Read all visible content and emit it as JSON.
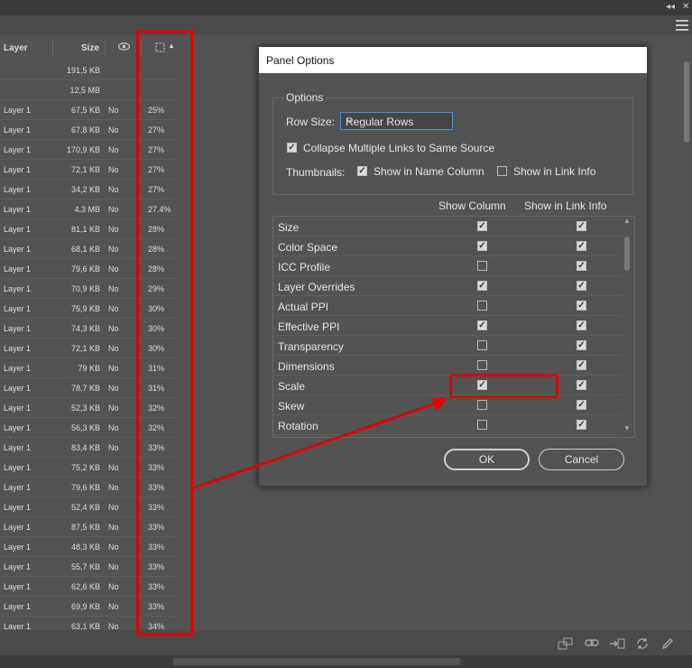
{
  "window": {
    "collapse_glyph": "◂◂",
    "close_glyph": "✕",
    "menu_icon": "hamburger-menu-icon"
  },
  "links_panel": {
    "columns": {
      "layer": "Layer",
      "size": "Size",
      "visibility_icon": "eye-icon",
      "scale_icon": "scale-column-icon",
      "sort_glyph": "▴"
    },
    "rows": [
      {
        "layer": "",
        "size": "191,5 KB",
        "vis": "",
        "scale": ""
      },
      {
        "layer": "",
        "size": "12,5 MB",
        "vis": "",
        "scale": ""
      },
      {
        "layer": "Layer 1",
        "size": "67,5 KB",
        "vis": "No",
        "scale": "25%"
      },
      {
        "layer": "Layer 1",
        "size": "67,8 KB",
        "vis": "No",
        "scale": "27%"
      },
      {
        "layer": "Layer 1",
        "size": "170,9 KB",
        "vis": "No",
        "scale": "27%"
      },
      {
        "layer": "Layer 1",
        "size": "72,1 KB",
        "vis": "No",
        "scale": "27%"
      },
      {
        "layer": "Layer 1",
        "size": "34,2 KB",
        "vis": "No",
        "scale": "27%"
      },
      {
        "layer": "Layer 1",
        "size": "4,3 MB",
        "vis": "No",
        "scale": "27.4%"
      },
      {
        "layer": "Layer 1",
        "size": "81,1 KB",
        "vis": "No",
        "scale": "28%"
      },
      {
        "layer": "Layer 1",
        "size": "68,1 KB",
        "vis": "No",
        "scale": "28%"
      },
      {
        "layer": "Layer 1",
        "size": "79,6 KB",
        "vis": "No",
        "scale": "28%"
      },
      {
        "layer": "Layer 1",
        "size": "70,9 KB",
        "vis": "No",
        "scale": "29%"
      },
      {
        "layer": "Layer 1",
        "size": "75,9 KB",
        "vis": "No",
        "scale": "30%"
      },
      {
        "layer": "Layer 1",
        "size": "74,3 KB",
        "vis": "No",
        "scale": "30%"
      },
      {
        "layer": "Layer 1",
        "size": "72,1 KB",
        "vis": "No",
        "scale": "30%"
      },
      {
        "layer": "Layer 1",
        "size": "79 KB",
        "vis": "No",
        "scale": "31%"
      },
      {
        "layer": "Layer 1",
        "size": "78,7 KB",
        "vis": "No",
        "scale": "31%"
      },
      {
        "layer": "Layer 1",
        "size": "52,3 KB",
        "vis": "No",
        "scale": "32%"
      },
      {
        "layer": "Layer 1",
        "size": "56,3 KB",
        "vis": "No",
        "scale": "32%"
      },
      {
        "layer": "Layer 1",
        "size": "83,4 KB",
        "vis": "No",
        "scale": "33%"
      },
      {
        "layer": "Layer 1",
        "size": "75,2 KB",
        "vis": "No",
        "scale": "33%"
      },
      {
        "layer": "Layer 1",
        "size": "79,6 KB",
        "vis": "No",
        "scale": "33%"
      },
      {
        "layer": "Layer 1",
        "size": "52,4 KB",
        "vis": "No",
        "scale": "33%"
      },
      {
        "layer": "Layer 1",
        "size": "87,5 KB",
        "vis": "No",
        "scale": "33%"
      },
      {
        "layer": "Layer 1",
        "size": "48,3 KB",
        "vis": "No",
        "scale": "33%"
      },
      {
        "layer": "Layer 1",
        "size": "55,7 KB",
        "vis": "No",
        "scale": "33%"
      },
      {
        "layer": "Layer 1",
        "size": "62,6 KB",
        "vis": "No",
        "scale": "33%"
      },
      {
        "layer": "Layer 1",
        "size": "69,9 KB",
        "vis": "No",
        "scale": "33%"
      },
      {
        "layer": "Layer 1",
        "size": "63,1 KB",
        "vis": "No",
        "scale": "34%"
      }
    ],
    "bottom_icons": [
      "relink-cc-icon",
      "link-icon",
      "goto-link-icon",
      "update-link-icon",
      "edit-original-icon"
    ]
  },
  "dialog": {
    "title": "Panel Options",
    "options_group": "Options",
    "row_size_label": "Row Size:",
    "row_size_value": "Regular Rows",
    "collapse_label": "Collapse Multiple Links to Same Source",
    "collapse_checked": true,
    "thumbnails_label": "Thumbnails:",
    "thumb_name_label": "Show in Name Column",
    "thumb_name_checked": true,
    "thumb_info_label": "Show in Link Info",
    "thumb_info_checked": false,
    "col_show_column": "Show Column",
    "col_show_info": "Show in Link Info",
    "items": [
      {
        "name": "Size",
        "show_column": true,
        "show_info": true
      },
      {
        "name": "Color Space",
        "show_column": true,
        "show_info": true
      },
      {
        "name": "ICC Profile",
        "show_column": false,
        "show_info": true
      },
      {
        "name": "Layer Overrides",
        "show_column": true,
        "show_info": true
      },
      {
        "name": "Actual PPI",
        "show_column": false,
        "show_info": true
      },
      {
        "name": "Effective PPI",
        "show_column": true,
        "show_info": true
      },
      {
        "name": "Transparency",
        "show_column": false,
        "show_info": true
      },
      {
        "name": "Dimensions",
        "show_column": false,
        "show_info": true
      },
      {
        "name": "Scale",
        "show_column": true,
        "show_info": true
      },
      {
        "name": "Skew",
        "show_column": false,
        "show_info": true
      },
      {
        "name": "Rotation",
        "show_column": false,
        "show_info": true
      }
    ],
    "ok_label": "OK",
    "cancel_label": "Cancel"
  },
  "annotation": {
    "color": "#e00000"
  }
}
